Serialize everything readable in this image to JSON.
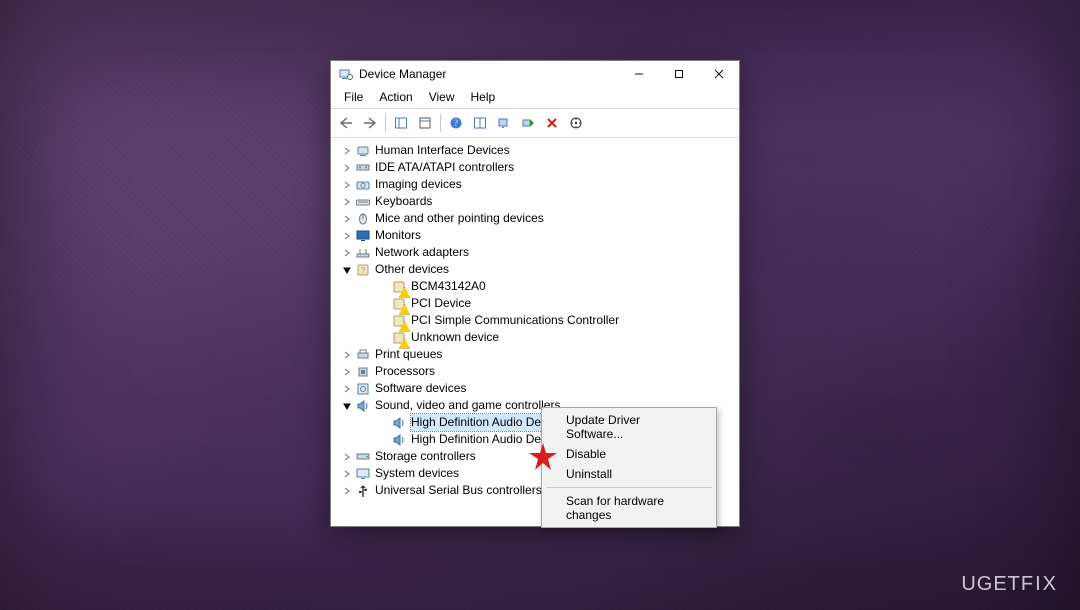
{
  "window": {
    "title": "Device Manager"
  },
  "menu": {
    "file": "File",
    "action": "Action",
    "view": "View",
    "help": "Help"
  },
  "tree": {
    "items": [
      {
        "label": "Human Interface Devices",
        "depth": 1,
        "exp": "closed",
        "icon": "hid"
      },
      {
        "label": "IDE ATA/ATAPI controllers",
        "depth": 1,
        "exp": "closed",
        "icon": "ide"
      },
      {
        "label": "Imaging devices",
        "depth": 1,
        "exp": "closed",
        "icon": "imaging"
      },
      {
        "label": "Keyboards",
        "depth": 1,
        "exp": "closed",
        "icon": "keyboard"
      },
      {
        "label": "Mice and other pointing devices",
        "depth": 1,
        "exp": "closed",
        "icon": "mouse"
      },
      {
        "label": "Monitors",
        "depth": 1,
        "exp": "closed",
        "icon": "monitor"
      },
      {
        "label": "Network adapters",
        "depth": 1,
        "exp": "closed",
        "icon": "network"
      },
      {
        "label": "Other devices",
        "depth": 1,
        "exp": "open",
        "icon": "other"
      },
      {
        "label": "BCM43142A0",
        "depth": 2,
        "exp": "none",
        "icon": "warn"
      },
      {
        "label": "PCI Device",
        "depth": 2,
        "exp": "none",
        "icon": "warn"
      },
      {
        "label": "PCI Simple Communications Controller",
        "depth": 2,
        "exp": "none",
        "icon": "warn"
      },
      {
        "label": "Unknown device",
        "depth": 2,
        "exp": "none",
        "icon": "warn"
      },
      {
        "label": "Print queues",
        "depth": 1,
        "exp": "closed",
        "icon": "printer"
      },
      {
        "label": "Processors",
        "depth": 1,
        "exp": "closed",
        "icon": "cpu"
      },
      {
        "label": "Software devices",
        "depth": 1,
        "exp": "closed",
        "icon": "software"
      },
      {
        "label": "Sound, video and game controllers",
        "depth": 1,
        "exp": "open",
        "icon": "sound"
      },
      {
        "label": "High Definition Audio Device",
        "depth": 2,
        "exp": "none",
        "icon": "sound",
        "selected": true
      },
      {
        "label": "High Definition Audio Device",
        "depth": 2,
        "exp": "none",
        "icon": "sound"
      },
      {
        "label": "Storage controllers",
        "depth": 1,
        "exp": "closed",
        "icon": "storage"
      },
      {
        "label": "System devices",
        "depth": 1,
        "exp": "closed",
        "icon": "system"
      },
      {
        "label": "Universal Serial Bus controllers",
        "depth": 1,
        "exp": "closed",
        "icon": "usb"
      }
    ]
  },
  "context_menu": {
    "update": "Update Driver Software...",
    "disable": "Disable",
    "uninstall": "Uninstall",
    "scan": "Scan for hardware changes"
  },
  "watermark": "UGETFIX"
}
